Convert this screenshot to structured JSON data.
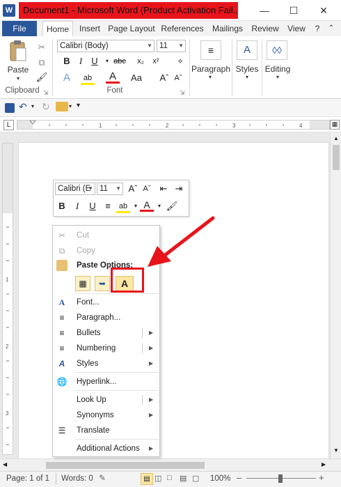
{
  "window": {
    "title": "Document1 - Microsoft Word (Product Activation Fail...",
    "controls": [
      "minimize-icon",
      "maximize-icon",
      "close-icon"
    ]
  },
  "tabs": [
    "File",
    "Home",
    "Insert",
    "Page Layout",
    "References",
    "Mailings",
    "Review",
    "View"
  ],
  "ribbon": {
    "paste_label": "Paste",
    "clipboard_label": "Clipboard",
    "font_name": "Calibri (Body)",
    "font_size": "11",
    "font_label": "Font",
    "paragraph_label": "Paragraph",
    "styles_label": "Styles",
    "editing_label": "Editing"
  },
  "mini_toolbar": {
    "font_name": "Calibri (E",
    "font_size": "11"
  },
  "context_menu": {
    "cut": "Cut",
    "copy": "Copy",
    "paste_options": "Paste Options:",
    "font": "Font...",
    "paragraph": "Paragraph...",
    "bullets": "Bullets",
    "numbering": "Numbering",
    "styles": "Styles",
    "hyperlink": "Hyperlink...",
    "look_up": "Look Up",
    "synonyms": "Synonyms",
    "translate": "Translate",
    "additional_actions": "Additional Actions"
  },
  "status": {
    "page": "Page: 1 of 1",
    "words": "Words: 0",
    "zoom": "100%"
  },
  "colors": {
    "accent_blue": "#2b579a",
    "annotation_red": "#e8141c"
  }
}
